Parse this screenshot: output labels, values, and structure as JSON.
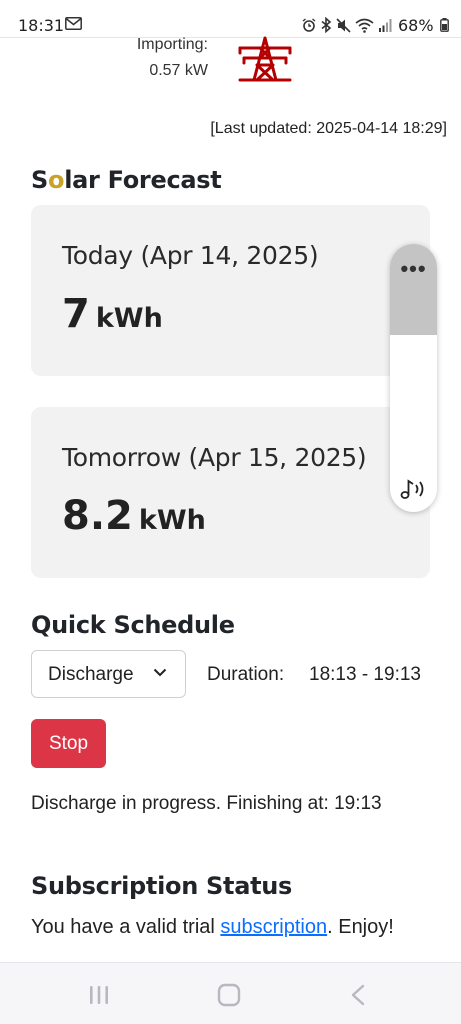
{
  "status_bar": {
    "time": "18:31",
    "battery": "68%",
    "icons": [
      "gmail-icon",
      "alarm-icon",
      "bluetooth-icon",
      "mute-icon",
      "wifi-icon",
      "signal-icon",
      "battery-icon"
    ]
  },
  "importing": {
    "label": "Importing:",
    "value": "0.57 kW",
    "icon": "power-pylon-icon",
    "icon_color": "#b30000"
  },
  "last_updated": "[Last updated: 2025-04-14 18:29]",
  "solar_forecast": {
    "title_s": "S",
    "title_o": "o",
    "title_rest": "lar Forecast",
    "accent_color": "#c9a227",
    "today": {
      "label": "Today (Apr 14, 2025)",
      "value": "7",
      "unit": "kWh"
    },
    "tomorrow": {
      "label": "Tomorrow (Apr 15, 2025)",
      "value": "8.2",
      "unit": "kWh"
    }
  },
  "volume_widget": {
    "menu": "•••",
    "icon": "sound-mode-icon",
    "level": 0.34
  },
  "quick_schedule": {
    "title": "Quick Schedule",
    "mode_selected": "Discharge",
    "duration_label": "Duration:",
    "duration_value": "18:13 - 19:13",
    "stop_label": "Stop",
    "stop_color": "#dc3545",
    "status": "Discharge in progress. Finishing at: 19:13"
  },
  "subscription": {
    "title": "Subscription Status",
    "text_before": "You have a valid trial ",
    "link_text": "subscription",
    "text_after": ". Enjoy!"
  },
  "nav_bar": {
    "icons": [
      "recent-apps-icon",
      "home-icon",
      "back-icon"
    ]
  }
}
